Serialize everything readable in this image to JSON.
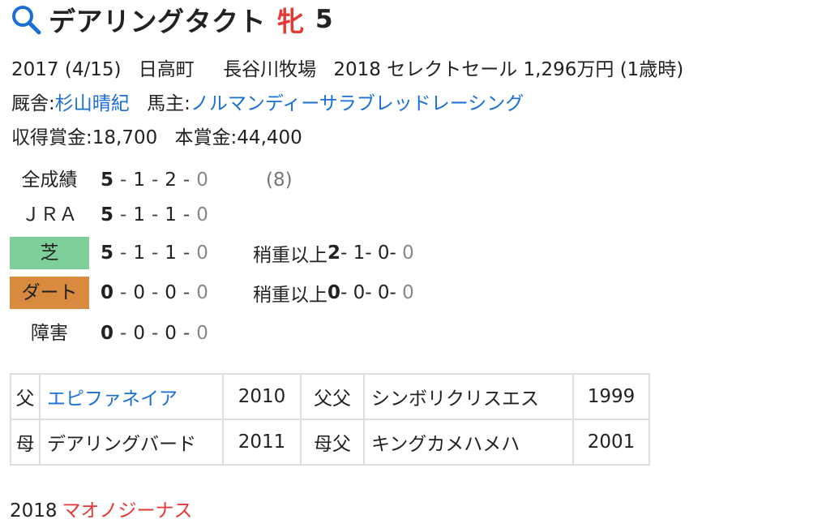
{
  "header": {
    "icon": "search-icon",
    "name": "デアリングタクト",
    "sex": "牝",
    "age": "5",
    "sex_color": "#e53935"
  },
  "profile": {
    "birth": "2017 (4/15)",
    "birthplace": "日高町",
    "breeder": "長谷川牧場",
    "sale": "2018 セレクトセール 1,296万円 (1歳時)",
    "trainer_label": "厩舎:",
    "trainer": "杉山晴紀",
    "owner_label": "馬主:",
    "owner": "ノルマンディーサラブレッドレーシング",
    "earnings_label": "収得賞金:",
    "earnings": "18,700",
    "prize_label": "本賞金:",
    "prize": "44,400"
  },
  "records": [
    {
      "label": "全成績",
      "w": "5",
      "s": "1",
      "t": "2",
      "o": "0",
      "extra": "(8)"
    },
    {
      "label": "ＪＲＡ",
      "w": "5",
      "s": "1",
      "t": "1",
      "o": "0"
    },
    {
      "label": "芝",
      "w": "5",
      "s": "1",
      "t": "1",
      "o": "0",
      "heavy_label": "稍重以上",
      "hw": "2",
      "hs": "1",
      "ht": "0",
      "ho": "0"
    },
    {
      "label": "ダート",
      "w": "0",
      "s": "0",
      "t": "0",
      "o": "0",
      "heavy_label": "稍重以上",
      "hw": "0",
      "hs": "0",
      "ht": "0",
      "ho": "0"
    },
    {
      "label": "障害",
      "w": "0",
      "s": "0",
      "t": "0",
      "o": "0"
    }
  ],
  "colors": {
    "turf": "#7dd09a",
    "dirt": "#d88a3e",
    "link": "#1a6fd6"
  },
  "pedigree": {
    "sire": {
      "label": "父",
      "name": "エピファネイア",
      "year": "2010",
      "sire_label": "父父",
      "sire_name": "シンボリクリスエス",
      "sire_year": "1999"
    },
    "dam": {
      "label": "母",
      "name": "デアリングバード",
      "year": "2011",
      "sire_label": "母父",
      "sire_name": "キングカメハメハ",
      "sire_year": "2001"
    }
  },
  "foals": [
    {
      "year": "2018",
      "name": "マオノジーナス"
    }
  ]
}
